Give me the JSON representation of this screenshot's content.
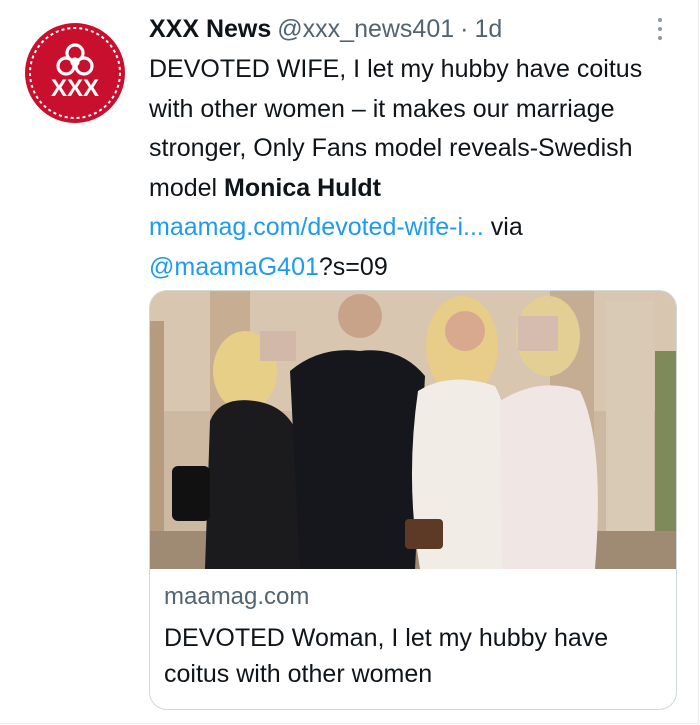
{
  "tweet": {
    "author_name": "XXX News",
    "handle": "@xxx_news401",
    "separator": "·",
    "time": "1d",
    "avatar_text": "XXX",
    "text_main": "DEVOTED WIFE, I let my hubby have coitus with other women – it makes our marriage stronger, Only Fans model reveals-Swedish model ",
    "text_bold": "Monica Huldt",
    "link_text": "maamag.com/devoted-wife-i...",
    "via_text": " via ",
    "mention": "@maamaG401",
    "suffix": "?s=09"
  },
  "card": {
    "domain": "maamag.com",
    "title": "DEVOTED Woman, I let my hubby have coitus with other women"
  },
  "colors": {
    "accent": "#1d9bf0",
    "avatar_red": "#c8102e",
    "secondary_text": "#536471"
  },
  "icons": {
    "more": "more-vertical-icon",
    "avatar_symbol": "biohazard-icon"
  }
}
